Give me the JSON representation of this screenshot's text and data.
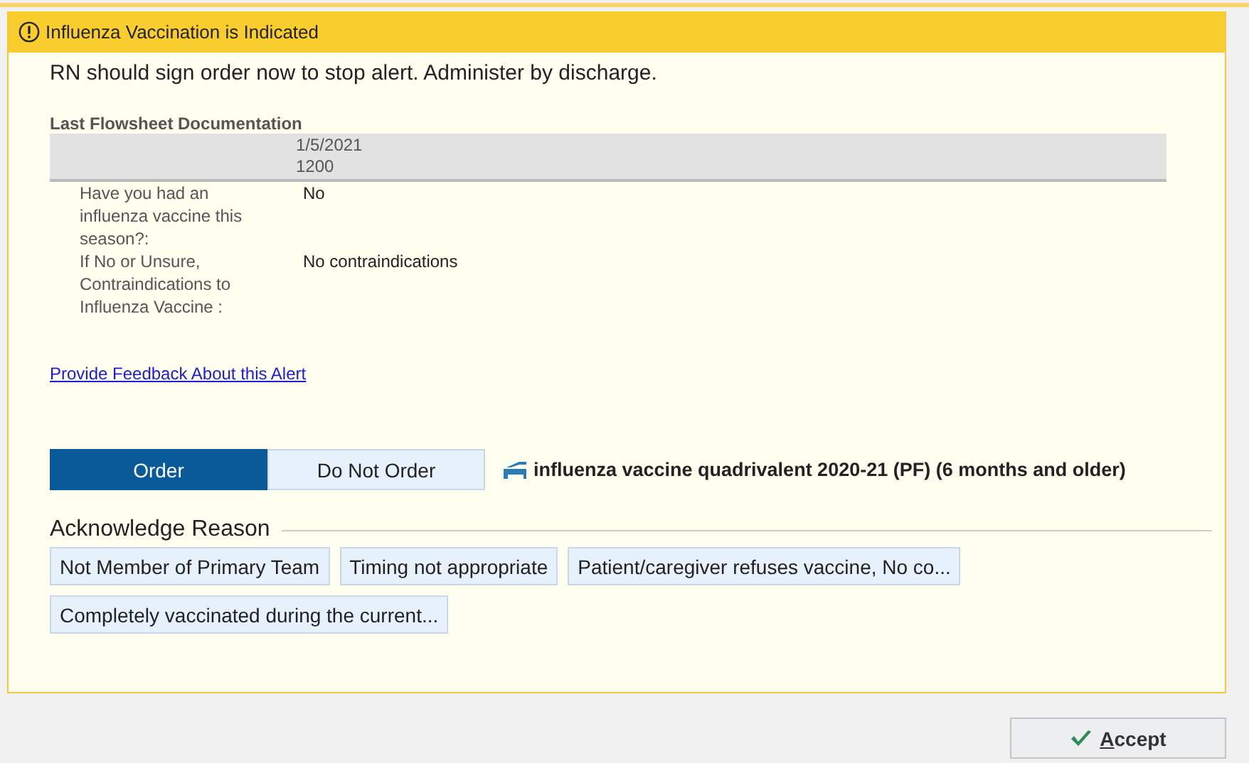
{
  "alert": {
    "title": "Influenza Vaccination is Indicated",
    "message": "RN should sign order now to stop alert. Administer by discharge.",
    "flowsheet": {
      "title": "Last Flowsheet Documentation",
      "date": "1/5/2021",
      "time": "1200",
      "rows": [
        {
          "question": "Have you had an influenza vaccine this season?:",
          "answer": "No"
        },
        {
          "question": "If No or Unsure, Contraindications to Influenza Vaccine :",
          "answer": "No contraindications"
        }
      ]
    },
    "feedback_link": "Provide Feedback About this Alert",
    "order_options": [
      {
        "label": "Order",
        "selected": true
      },
      {
        "label": "Do Not Order",
        "selected": false
      }
    ],
    "order_item": "influenza vaccine quadrivalent 2020-21 (PF) (6 months and older)",
    "acknowledge": {
      "title": "Acknowledge Reason",
      "reasons": [
        {
          "label": "Not Member of Primary Team",
          "selected": false
        },
        {
          "label": "Timing not appropriate",
          "selected": false
        },
        {
          "label": "Patient/caregiver refuses vaccine, No co...",
          "selected": false
        },
        {
          "label": "Completely vaccinated during the current...",
          "selected": false
        }
      ]
    }
  },
  "footer": {
    "accept_button": {
      "mnemonic": "A",
      "rest": "ccept"
    }
  }
}
